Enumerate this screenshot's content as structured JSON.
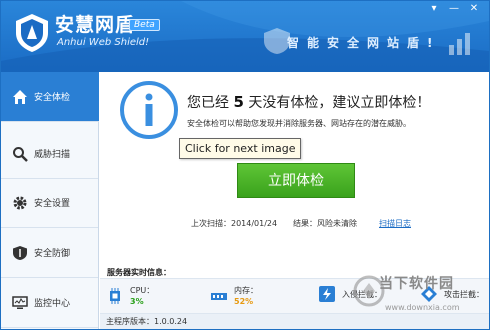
{
  "header": {
    "title": "安慧网盾",
    "subtitle": "Anhui Web Shield!",
    "badge": "Beta",
    "slogan": "智能安全网站盾!",
    "window_buttons": [
      "▾",
      "—",
      "✕"
    ]
  },
  "sidebar": {
    "items": [
      {
        "label": "安全体检",
        "icon": "home-icon",
        "active": true
      },
      {
        "label": "威胁扫描",
        "icon": "magnifier-icon"
      },
      {
        "label": "安全设置",
        "icon": "gear-icon"
      },
      {
        "label": "安全防御",
        "icon": "shield-icon"
      },
      {
        "label": "监控中心",
        "icon": "monitor-icon"
      }
    ]
  },
  "main": {
    "headline_pre": "您已经",
    "headline_days": "5",
    "headline_post": "天没有体检，建议立即体检！",
    "description": "安全体检可以帮助您发现并消除服务器、网站存在的潜在威胁。",
    "tooltip": "Click for next image",
    "scan_button": "立即体检",
    "last_scan": "上次扫描：2014/01/24",
    "result": "结果：风险未清除",
    "log_link": "扫描日志"
  },
  "monitor": {
    "title": "服务器实时信息：",
    "items": [
      {
        "label": "CPU：",
        "value": "3%",
        "icon": "cpu-icon"
      },
      {
        "label": "内存：",
        "value": "52%",
        "icon": "memory-icon"
      },
      {
        "label": "入侵拦截：",
        "value": "",
        "icon": "intrusion-icon"
      },
      {
        "label": "攻击拦截：",
        "value": "",
        "icon": "attack-icon"
      }
    ]
  },
  "footer": {
    "version": "主程序版本：1.0.0.24"
  },
  "watermark": {
    "text": "当下软件园",
    "url": "www.downxia.com"
  },
  "colors": {
    "header": "#1a6bc4",
    "accent": "#2a7fd4",
    "button": "#3aa21c"
  }
}
